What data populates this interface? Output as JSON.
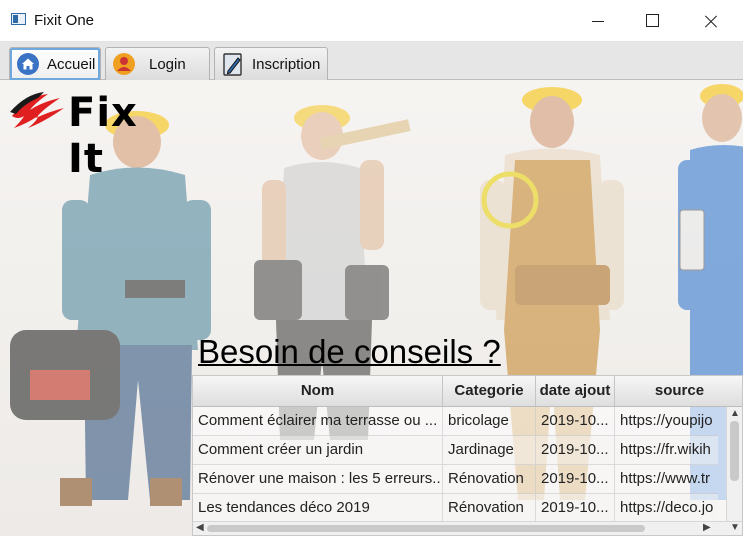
{
  "window": {
    "title": "Fixit One"
  },
  "tabs": [
    {
      "label": "Accueil",
      "icon": "home-icon",
      "active": true
    },
    {
      "label": "Login",
      "icon": "user-icon",
      "active": false
    },
    {
      "label": "Inscription",
      "icon": "clipboard-pen-icon",
      "active": false
    }
  ],
  "logo": {
    "text": "Fix It"
  },
  "headline": "Besoin de conseils ?",
  "table": {
    "columns": [
      "Nom",
      "Categorie",
      "date ajout",
      "source"
    ],
    "rows": [
      [
        "Comment éclairer ma terrasse ou ...",
        "bricolage",
        "2019-10...",
        "https://youpijo"
      ],
      [
        "Comment créer un jardin",
        "Jardinage",
        "2019-10...",
        "https://fr.wikih"
      ],
      [
        "Rénover une maison : les 5 erreurs...",
        "Rénovation",
        "2019-10...",
        "https://www.tr"
      ],
      [
        "Les tendances déco 2019",
        "Rénovation",
        "2019-10...",
        "https://deco.jo"
      ]
    ]
  },
  "colors": {
    "tab_active_border": "#6fa8dc",
    "logo_red": "#e02020",
    "helmet_yellow": "#f5c518"
  }
}
